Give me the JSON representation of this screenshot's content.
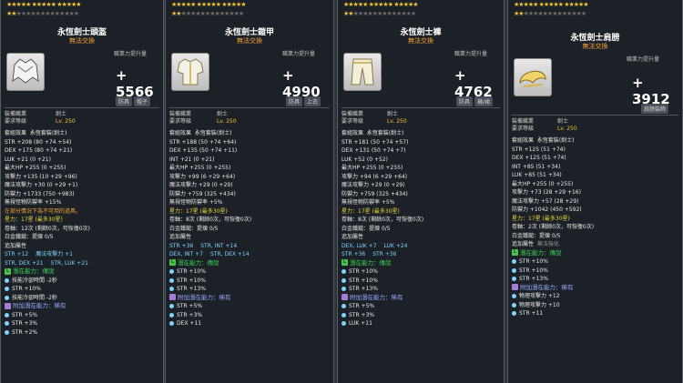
{
  "panels": [
    {
      "title": "永恆劍士頭盔",
      "subtitle": "無法交換",
      "increase_label": "職業力提升量",
      "increase_value": "+ 5566",
      "tags": [
        "防具",
        "帽子"
      ],
      "req_job_label": "裝備職業",
      "req_job_value": "劍士",
      "req_level_label": "要求等級",
      "req_level_value": "Lv. 250",
      "set_label": "套組效果",
      "set_value": "永恆套裝(劍士)",
      "stats": [
        "STR +208 (80 +74 +54)",
        "DEX +175 (80 +74 +21)",
        "LUK +21 (0 +21)",
        "最大HP +255 (0 +255)",
        "攻擊力 +135 (10 +29 +96)",
        "魔法攻擊力 +30 (0 +29 +1)",
        "防禦力 +1733 (750 +983)",
        "無視怪物防禦率 +15%"
      ],
      "notice": "在部分情況下為不可用的道具。",
      "star_line": "星力：17星 (最多30星)",
      "hammer_line": "卷軸：12次 (剩餘0次，可恢復0次)",
      "gold_hammer_line": "白金鐵鎚：提煉 0/5",
      "bonus_label": "追加屬性",
      "bonus": [
        "STR +12",
        "魔法攻擊力 +1",
        "STR, DEX +21",
        "STR, LUK +21"
      ],
      "potential_label": "潛在能力：傳說",
      "potentials": [
        "技能冷卻時間 -2秒",
        "STR +10%",
        "技能冷卻時間 -2秒"
      ],
      "addpot_label": "附加潛在能力：稀有",
      "addpots": [
        "STR +5%",
        "STR +3%",
        "STR +2%"
      ]
    },
    {
      "title": "永恆劍士鎧甲",
      "subtitle": "無法交換",
      "increase_label": "職業力提升量",
      "increase_value": "+ 4990",
      "tags": [
        "防具",
        "上衣"
      ],
      "req_job_label": "裝備職業",
      "req_job_value": "劍士",
      "req_level_label": "要求等級",
      "req_level_value": "Lv. 250",
      "set_label": "套組效果",
      "set_value": "永恆套裝(劍士)",
      "stats": [
        "STR +188 (50 +74 +64)",
        "DEX +135 (50 +74 +11)",
        "INT +21 (0 +21)",
        "最大HP +255 (0 +255)",
        "攻擊力 +99 (6 +29 +64)",
        "魔法攻擊力 +29 (0 +29)",
        "防禦力 +759 (325 +434)",
        "無視怪物防禦率 +5%"
      ],
      "star_line": "星力：17星 (最多30星)",
      "hammer_line": "卷軸：8次 (剩餘0次，可恢復0次)",
      "gold_hammer_line": "白金鐵鎚：提煉 0/5",
      "bonus_label": "追加屬性",
      "bonus": [
        "STR +36",
        "STR, INT +14",
        "DEX, INT +7",
        "STR, DEX +14"
      ],
      "potential_label": "潛在能力：傳說",
      "potentials": [
        "STR +10%",
        "STR +10%",
        "STR +13%"
      ],
      "addpot_label": "附加潛在能力：稀有",
      "addpots": [
        "STR +5%",
        "STR +3%",
        "DEX +11"
      ]
    },
    {
      "title": "永恆劍士褲",
      "subtitle": "無法交換",
      "increase_label": "職業力提升量",
      "increase_value": "+ 4762",
      "tags": [
        "防具",
        "褲/裙"
      ],
      "req_job_label": "裝備職業",
      "req_job_value": "劍士",
      "req_level_label": "要求等級",
      "req_level_value": "Lv. 250",
      "set_label": "套組效果",
      "set_value": "永恆套裝(劍士)",
      "stats": [
        "STR +181 (50 +74 +57)",
        "DEX +131 (50 +74 +7)",
        "LUK +52 (0 +52)",
        "最大HP +255 (0 +255)",
        "攻擊力 +94 (6 +29 +64)",
        "魔法攻擊力 +29 (0 +29)",
        "防禦力 +759 (325 +434)",
        "無視怪物防禦率 +5%"
      ],
      "star_line": "星力：17星 (最多30星)",
      "hammer_line": "卷軸：8次 (剩餘0次，可恢復0次)",
      "gold_hammer_line": "白金鐵鎚：提煉 0/5",
      "bonus_label": "追加屬性",
      "bonus": [
        "DEX, LUK +7",
        "LUK +24",
        "STR +36",
        "STR +36"
      ],
      "potential_label": "潛在能力：傳說",
      "potentials": [
        "STR +10%",
        "STR +10%",
        "STR +13%"
      ],
      "addpot_label": "附加潛在能力：稀有",
      "addpots": [
        "STR +5%",
        "STR +3%",
        "LUK +11"
      ]
    },
    {
      "title": "永恆劍士肩膀",
      "subtitle": "無法交換",
      "increase_label": "職業力提升量",
      "increase_value": "+ 3912",
      "tags": [
        "肩膀裝飾"
      ],
      "req_job_label": "裝備職業",
      "req_job_value": "劍士",
      "req_level_label": "要求等級",
      "req_level_value": "Lv. 250",
      "set_label": "套組效果",
      "set_value": "永恆套裝(劍士)",
      "stats": [
        "STR +125 (51 +74)",
        "DEX +125 (51 +74)",
        "INT +85 (51 +34)",
        "LUK +85 (51 +34)",
        "最大HP +255 (0 +255)",
        "攻擊力 +73 (28 +29 +16)",
        "魔法攻擊力 +57 (28 +29)",
        "防禦力 +1042 (450 +592)"
      ],
      "star_line": "星力：17星 (最多30星)",
      "hammer_line": "卷軸：2次 (剩餘0次，可恢復0次)",
      "gold_hammer_line": "白金鐵鎚：提煉 0/5",
      "bonus_label": "追加屬性",
      "bonus": [
        "無法強化"
      ],
      "potential_label": "潛在能力：傳說",
      "potentials": [
        "STR +10%",
        "STR +10%",
        "STR +13%"
      ],
      "addpot_label": "附加潛在能力：稀有",
      "addpots": [
        "物理攻擊力 +12",
        "物理攻擊力 +10",
        "STR +11"
      ]
    }
  ]
}
